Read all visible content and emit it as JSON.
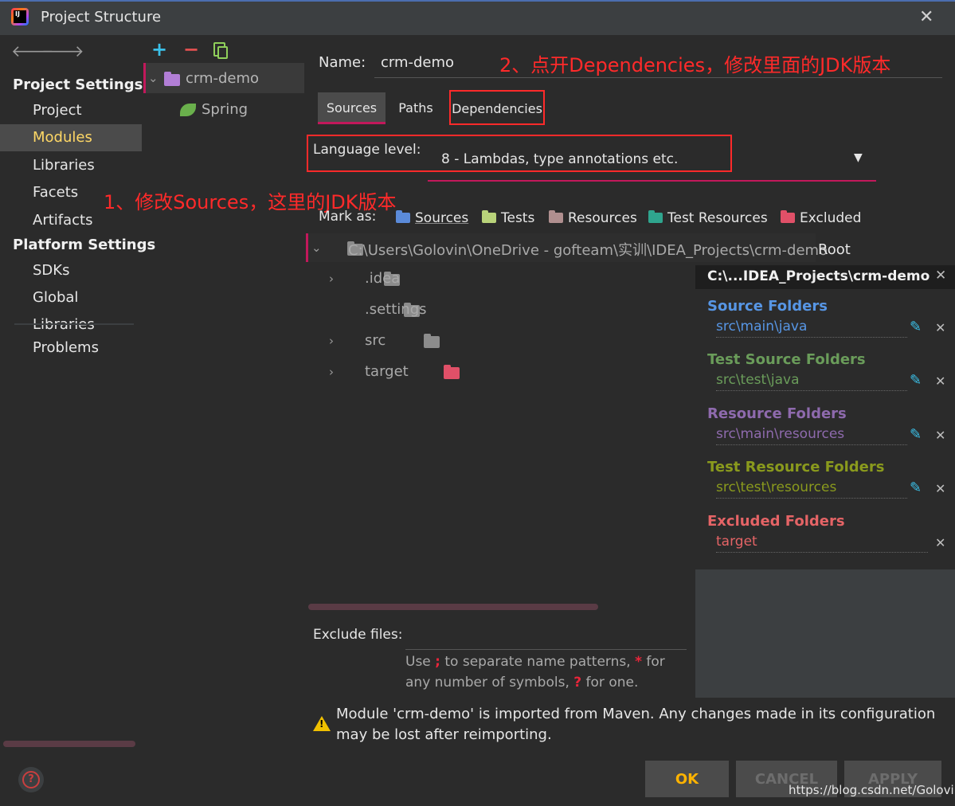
{
  "window": {
    "title": "Project Structure",
    "logo_text": "IJ"
  },
  "sidebar": {
    "project_settings": "Project Settings",
    "project_items": [
      "Project",
      "Modules",
      "Libraries",
      "Facets",
      "Artifacts"
    ],
    "selected": "Modules",
    "platform_settings": "Platform Settings",
    "platform_items": [
      "SDKs",
      "Global Libraries"
    ],
    "problems": "Problems"
  },
  "module_tree": {
    "module": "crm-demo",
    "facet": "Spring"
  },
  "main": {
    "name_label": "Name:",
    "name_value": "crm-demo",
    "tabs": [
      "Sources",
      "Paths",
      "Dependencies"
    ],
    "active_tab": "Sources",
    "language_label": "Language level:",
    "language_value": "8 - Lambdas, type annotations etc.",
    "mark_as_label": "Mark as:",
    "mark_as": [
      {
        "label": "Sources",
        "color": "#5b8bd9"
      },
      {
        "label": "Tests",
        "color": "#b9d37a"
      },
      {
        "label": "Resources",
        "color": "#b08f8f"
      },
      {
        "label": "Test Resources",
        "color": "#2fa58e"
      },
      {
        "label": "Excluded",
        "color": "#e05068"
      }
    ],
    "root_path": "C:\\Users\\Golovin\\OneDrive - gofteam\\实训\\IDEA_Projects\\crm-demo",
    "root_suffix": "Root",
    "tree": [
      {
        "name": ".idea",
        "expandable": true
      },
      {
        "name": ".settings",
        "expandable": false
      },
      {
        "name": "src",
        "expandable": true
      },
      {
        "name": "target",
        "expandable": true
      }
    ],
    "exclude_label": "Exclude files:",
    "exclude_help": {
      "use": "Use",
      "semi": ";",
      "to_separate": "to separate name patterns,",
      "star": "*",
      "for": "for",
      "any": "any number of symbols,",
      "q": "?",
      "for_one": "for one."
    }
  },
  "annotations": {
    "one": "1、修改Sources，这里的JDK版本",
    "two": "2、点开Dependencies，修改里面的JDK版本"
  },
  "roots_panel": {
    "title": "C:\\...IDEA_Projects\\crm-demo",
    "groups": [
      {
        "title": "Source Folders",
        "path": "src\\main\\java",
        "color": "#5796e5"
      },
      {
        "title": "Test Source Folders",
        "path": "src\\test\\java",
        "color": "#6a9c5a"
      },
      {
        "title": "Resource Folders",
        "path": "src\\main\\resources",
        "color": "#8e6aad"
      },
      {
        "title": "Test Resource Folders",
        "path": "src\\test\\resources",
        "color": "#8a9a1d"
      },
      {
        "title": "Excluded Folders",
        "path": "target",
        "color": "#e56466"
      }
    ]
  },
  "warning": "Module 'crm-demo' is imported from Maven. Any changes made in its configuration may be lost after reimporting.",
  "buttons": {
    "ok": "OK",
    "cancel": "CANCEL",
    "apply": "APPLY"
  },
  "watermark": "https://blog.csdn.net/Golovin",
  "colors": {
    "accent": "#c2185b",
    "annotation_red": "#ff2a2a",
    "ok_text": "#ffb300"
  }
}
